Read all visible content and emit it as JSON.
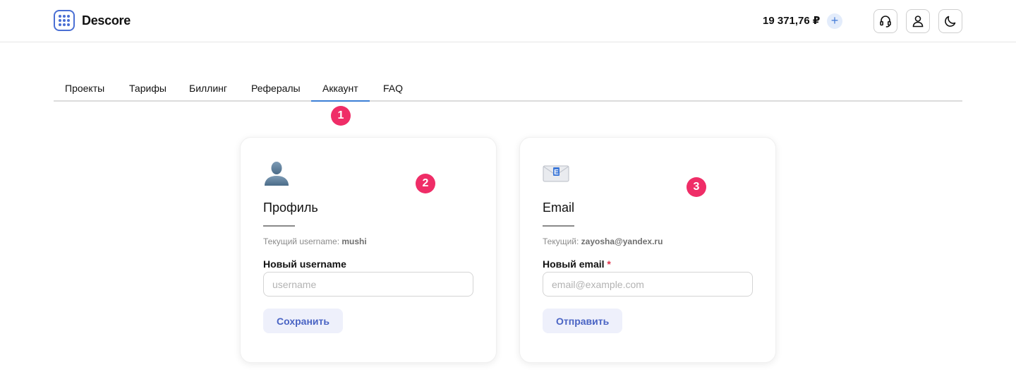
{
  "header": {
    "brand": "Descore",
    "balance": "19 371,76 ₽",
    "add_label": "+"
  },
  "icons": {
    "logo": "grid-dots-icon",
    "support": "headset-icon",
    "profile": "user-icon",
    "theme": "moon-icon"
  },
  "tabs": [
    {
      "label": "Проекты"
    },
    {
      "label": "Тарифы"
    },
    {
      "label": "Биллинг"
    },
    {
      "label": "Рефералы"
    },
    {
      "label": "Аккаунт",
      "active": true
    },
    {
      "label": "FAQ"
    }
  ],
  "badges": [
    "1",
    "2",
    "3"
  ],
  "profile_card": {
    "title": "Профиль",
    "current_prefix": "Текущий username:",
    "current_value": "mushi",
    "field_label": "Новый username",
    "placeholder": "username",
    "button": "Сохранить"
  },
  "email_card": {
    "title": "Email",
    "current_prefix": "Текущий:",
    "current_value": "zayosha@yandex.ru",
    "field_label": "Новый email",
    "required_mark": "*",
    "placeholder": "email@example.com",
    "button": "Отправить"
  },
  "colors": {
    "accent": "#3b7fd6",
    "badge": "#ef2d67",
    "button_bg": "#eef0fb",
    "button_text": "#4a64c4"
  }
}
